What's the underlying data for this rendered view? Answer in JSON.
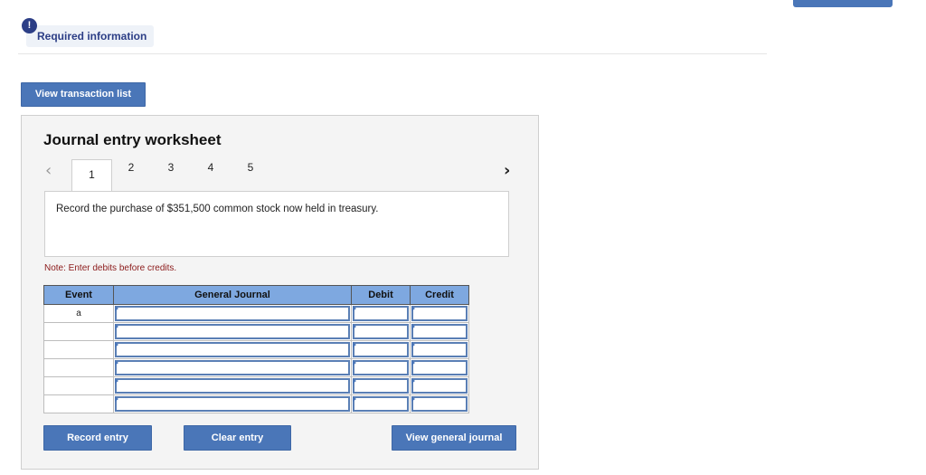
{
  "header": {
    "required_icon": "!",
    "required_label": "Required information"
  },
  "actions": {
    "view_transaction_list": "View transaction list"
  },
  "worksheet": {
    "title": "Journal entry worksheet",
    "tabs": [
      "1",
      "2",
      "3",
      "4",
      "5"
    ],
    "active_tab": "1",
    "prev_icon": "chevron-left-icon",
    "next_icon": "chevron-right-icon",
    "description": "Record the purchase of $351,500 common stock now held in treasury.",
    "note": "Note: Enter debits before credits.",
    "table": {
      "headers": [
        "Event",
        "General Journal",
        "Debit",
        "Credit"
      ],
      "rows": [
        {
          "event": "a",
          "general_journal": "",
          "debit": "",
          "credit": ""
        },
        {
          "event": "",
          "general_journal": "",
          "debit": "",
          "credit": ""
        },
        {
          "event": "",
          "general_journal": "",
          "debit": "",
          "credit": ""
        },
        {
          "event": "",
          "general_journal": "",
          "debit": "",
          "credit": ""
        },
        {
          "event": "",
          "general_journal": "",
          "debit": "",
          "credit": ""
        },
        {
          "event": "",
          "general_journal": "",
          "debit": "",
          "credit": ""
        }
      ]
    },
    "buttons": {
      "record": "Record entry",
      "clear": "Clear entry",
      "view_general_journal": "View general journal"
    }
  },
  "colors": {
    "button_blue": "#4a76b8",
    "header_blue": "#7ea8e0",
    "note_red": "#8b1a1a",
    "icon_navy": "#2c3e86"
  }
}
